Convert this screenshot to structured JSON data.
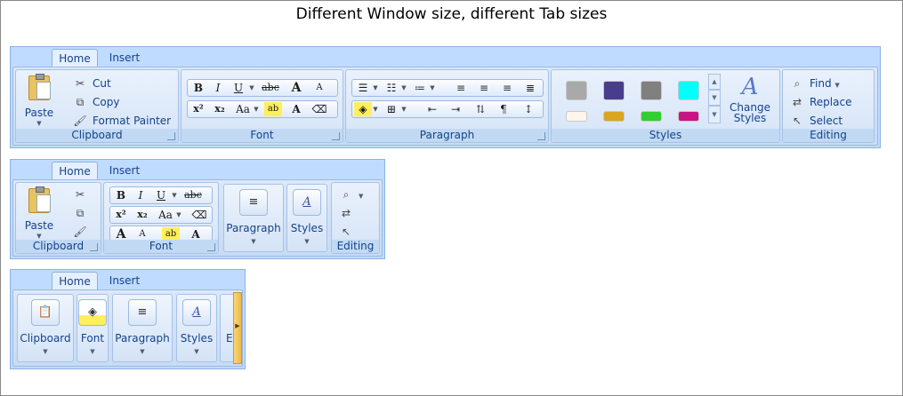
{
  "title": "Different Window size, different Tab sizes",
  "tabs": [
    "Home",
    "Insert"
  ],
  "groups": {
    "clipboard": "Clipboard",
    "font": "Font",
    "paragraph": "Paragraph",
    "styles": "Styles",
    "editing": "Editing"
  },
  "clipboard": {
    "paste": "Paste",
    "cut": "Cut",
    "copy": "Copy",
    "format_painter": "Format Painter"
  },
  "editing": {
    "find": "Find",
    "replace": "Replace",
    "select": "Select"
  },
  "styles": {
    "change_styles_1": "Change",
    "change_styles_2": "Styles"
  },
  "style_colors": [
    "#a9a9a9",
    "#483d8b",
    "#808080",
    "#00ffff",
    "#fff5ee",
    "#daa520",
    "#32cd32",
    "#c71585"
  ],
  "font_glyphs": {
    "bold": "B",
    "italic": "I",
    "underline": "U",
    "strike": "abc",
    "grow": "A",
    "shrink": "A",
    "superscript": "x²",
    "subscript": "x₂",
    "case": "Aa",
    "highlight": "ab",
    "color": "A"
  },
  "partial_editing_label": "E"
}
